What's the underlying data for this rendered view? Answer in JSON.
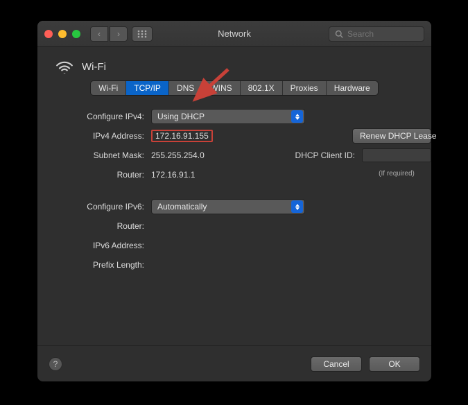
{
  "window": {
    "title": "Network",
    "search_placeholder": "Search"
  },
  "header": {
    "interface_name": "Wi-Fi"
  },
  "tabs": [
    {
      "label": "Wi-Fi",
      "active": false
    },
    {
      "label": "TCP/IP",
      "active": true
    },
    {
      "label": "DNS",
      "active": false
    },
    {
      "label": "WINS",
      "active": false
    },
    {
      "label": "802.1X",
      "active": false
    },
    {
      "label": "Proxies",
      "active": false
    },
    {
      "label": "Hardware",
      "active": false
    }
  ],
  "ipv4": {
    "configure_label": "Configure IPv4:",
    "configure_value": "Using DHCP",
    "address_label": "IPv4 Address:",
    "address_value": "172.16.91.155",
    "subnet_label": "Subnet Mask:",
    "subnet_value": "255.255.254.0",
    "router_label": "Router:",
    "router_value": "172.16.91.1",
    "renew_label": "Renew DHCP Lease",
    "dhcp_client_label": "DHCP Client ID:",
    "dhcp_client_value": "",
    "if_required": "(If required)"
  },
  "ipv6": {
    "configure_label": "Configure IPv6:",
    "configure_value": "Automatically",
    "router_label": "Router:",
    "router_value": "",
    "address_label": "IPv6 Address:",
    "address_value": "",
    "prefix_label": "Prefix Length:",
    "prefix_value": ""
  },
  "footer": {
    "cancel": "Cancel",
    "ok": "OK"
  },
  "annotation": {
    "arrow_color": "#c84138",
    "highlight_color": "#c84138",
    "points_to": "tcpip-tab"
  }
}
